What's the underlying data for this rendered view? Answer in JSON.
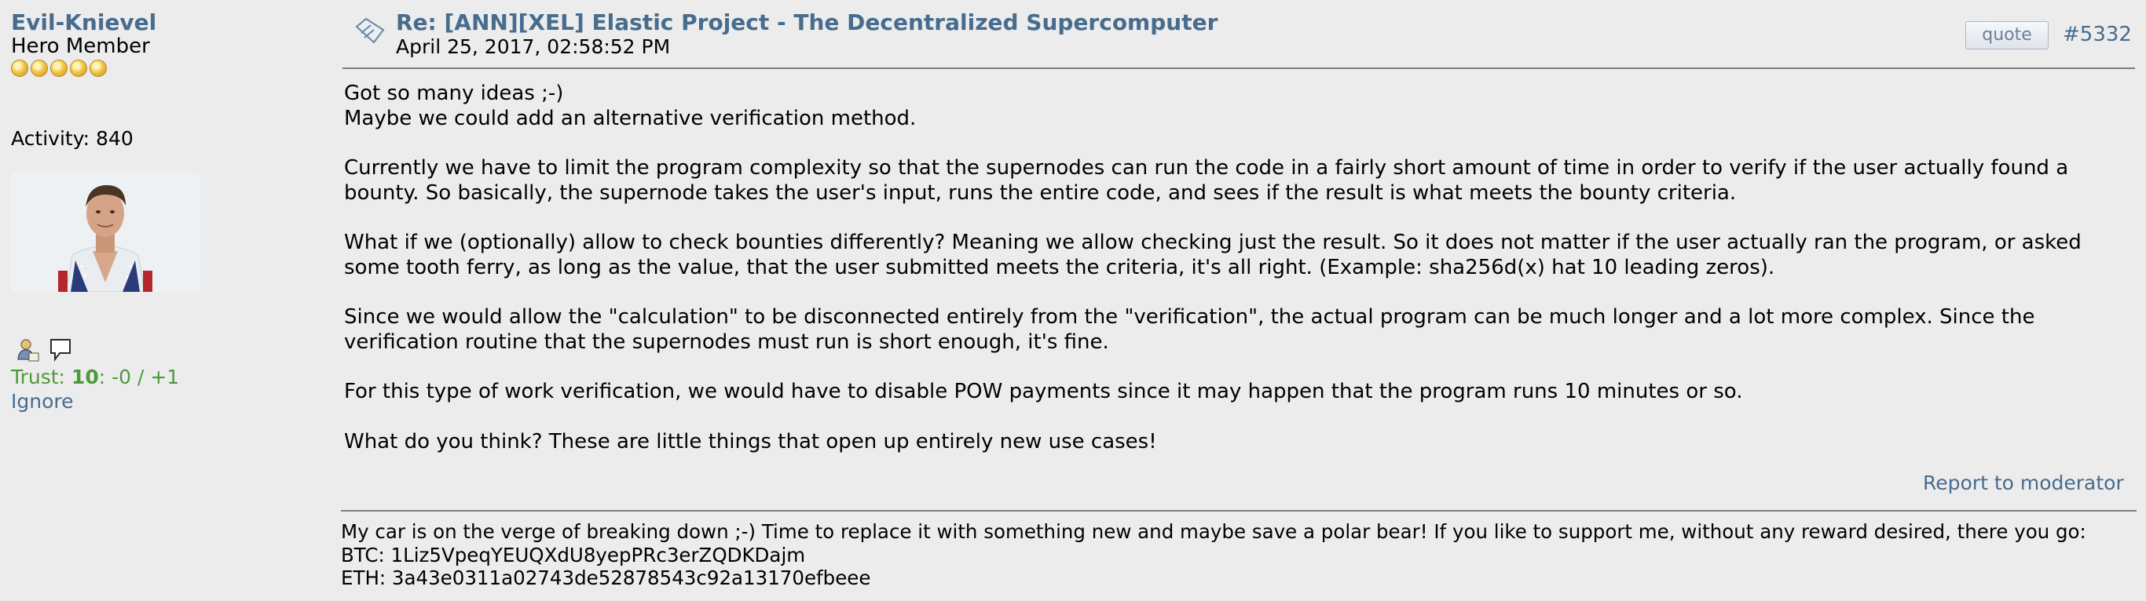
{
  "poster": {
    "name": "Evil-Knievel",
    "rank": "Hero Member",
    "activity": "Activity: 840",
    "trust_label": "Trust: ",
    "trust_score": "10",
    "trust_detail": ": -0 / +1",
    "ignore": "Ignore"
  },
  "post": {
    "subject": "Re: [ANN][XEL] Elastic Project - The Decentralized Supercomputer",
    "date": "April 25, 2017, 02:58:52 PM",
    "quote_label": "quote",
    "number": "#5332",
    "body": {
      "p1_l1": "Got so many ideas ;-)",
      "p1_l2": "Maybe we could add an alternative verification method.",
      "p2_l1": "Currently we have to limit the program complexity so that the supernodes can run the code in a fairly short amount of time in order to verify if the user actually found a",
      "p2_l2": "bounty. So basically, the supernode takes the user's input, runs the entire code, and sees if the result is what meets the bounty criteria.",
      "p3_l1": "What if we (optionally) allow to check bounties differently? Meaning we allow checking just the result. So it does not matter if the user actually ran the program, or asked",
      "p3_l2": "some tooth ferry, as long as the value, that the user submitted meets the criteria, it's all right. (Example: sha256d(x) hat 10 leading zeros).",
      "p4_l1": "Since we would allow the \"calculation\" to be disconnected entirely  from the \"verification\", the actual program can be much longer and a lot more complex. Since the",
      "p4_l2": "verification routine that the supernodes must run is short enough, it's fine.",
      "p5": "For this type of work verification, we would have to disable POW payments since it may happen that the program runs 10 minutes or so.",
      "p6": "What do you think? These are little things that open up entirely new use cases!"
    },
    "report": "Report to moderator"
  },
  "signature": {
    "line1": "My car is on the verge of breaking down ;-) Time to replace it with something new and maybe save a polar bear! If you like to support me, without any reward desired, there you go:",
    "btc": "BTC: 1Liz5VpeqYEUQXdU8yepPRc3erZQDKDajm",
    "eth": "ETH: 3a43e0311a02743de52878543c92a13170efbeee"
  },
  "icons": {
    "rank_stars": 5,
    "topic": "topic-icon",
    "profile": "profile-icon",
    "message": "message-icon"
  },
  "colors": {
    "link": "#476c8e",
    "trust": "#4b9a3b",
    "background": "#ececec",
    "star": "#f2c74a"
  }
}
